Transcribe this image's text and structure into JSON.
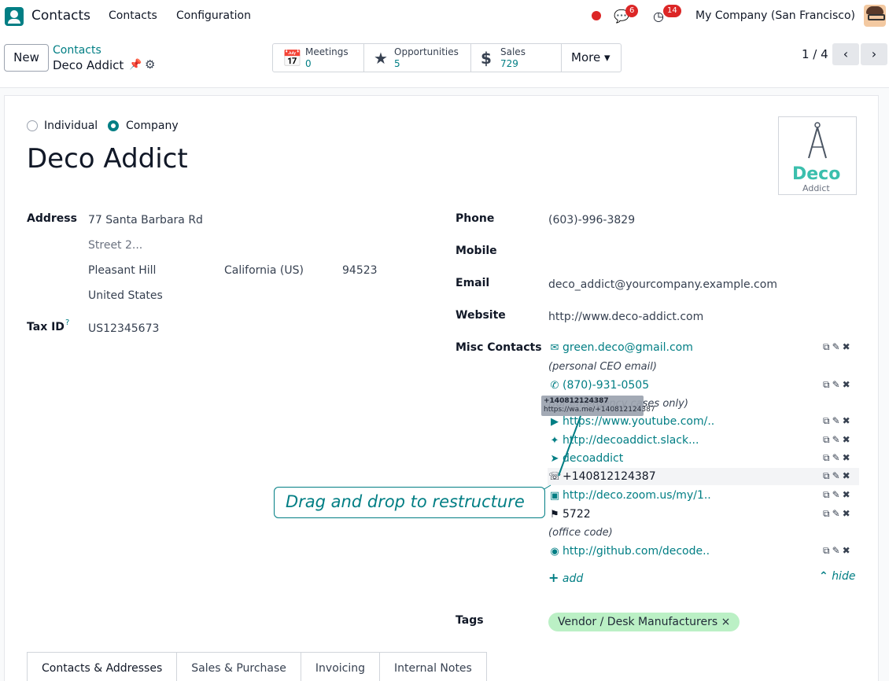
{
  "navbar": {
    "app_name": "Contacts",
    "menu": [
      "Contacts",
      "Configuration"
    ],
    "chat_count": "6",
    "activity_count": "14",
    "company": "My Company (San Francisco)"
  },
  "control": {
    "new_label": "New",
    "breadcrumb_parent": "Contacts",
    "breadcrumb_current": "Deco Addict",
    "smart_buttons": [
      {
        "label": "Meetings",
        "value": "0",
        "icon": "calendar-icon"
      },
      {
        "label": "Opportunities",
        "value": "5",
        "icon": "star-icon"
      },
      {
        "label": "Sales",
        "value": "729",
        "icon": "dollar-icon"
      }
    ],
    "more_label": "More ▾",
    "pager": "1 / 4"
  },
  "form": {
    "type_options": [
      "Individual",
      "Company"
    ],
    "selected_type": "Company",
    "name": "Deco Addict",
    "logo_text": "Deco",
    "logo_subtext": "Addict",
    "address_label": "Address",
    "street": "77 Santa Barbara Rd",
    "street2": "Street 2...",
    "city": "Pleasant Hill",
    "state": "California (US)",
    "zip": "94523",
    "country": "United States",
    "tax_label": "Tax ID",
    "tax_help": "?",
    "tax_id": "US12345673",
    "phone_label": "Phone",
    "phone": "(603)-996-3829",
    "mobile_label": "Mobile",
    "email_label": "Email",
    "email": "deco_addict@yourcompany.example.com",
    "website_label": "Website",
    "website": "http://www.deco-addict.com",
    "misc_label": "Misc Contacts",
    "misc": [
      {
        "icon": "email-icon",
        "text": "green.deco@gmail.com",
        "note": "(personal CEO email)"
      },
      {
        "icon": "phone-icon",
        "text": "(870)-931-0505",
        "note": "(for emergency cases only)"
      },
      {
        "icon": "youtube-icon",
        "text": "https://www.youtube.com/.."
      },
      {
        "icon": "slack-icon",
        "text": "http://decoaddict.slack..."
      },
      {
        "icon": "telegram-icon",
        "text": "decoaddict"
      },
      {
        "icon": "whatsapp-icon",
        "text": "+140812124387"
      },
      {
        "icon": "zoom-icon",
        "text": "http://deco.zoom.us/my/1.."
      },
      {
        "icon": "tag-icon",
        "text": "5722",
        "note": "(office code)"
      },
      {
        "icon": "github-icon",
        "text": "http://github.com/decode.."
      }
    ],
    "add_label": "add",
    "hide_label": "hide",
    "tooltip_line1": "+140812124387",
    "tooltip_line2": "https://wa.me/+140812124387",
    "drag_hint": "Drag and drop to restructure",
    "tags_label": "Tags",
    "tag": "Vendor / Desk Manufacturers ×",
    "tabs": [
      "Contacts & Addresses",
      "Sales & Purchase",
      "Invoicing",
      "Internal Notes"
    ]
  },
  "colors": {
    "accent": "#017e84",
    "badge": "#dc2626",
    "tag": "#bbf0c5"
  }
}
